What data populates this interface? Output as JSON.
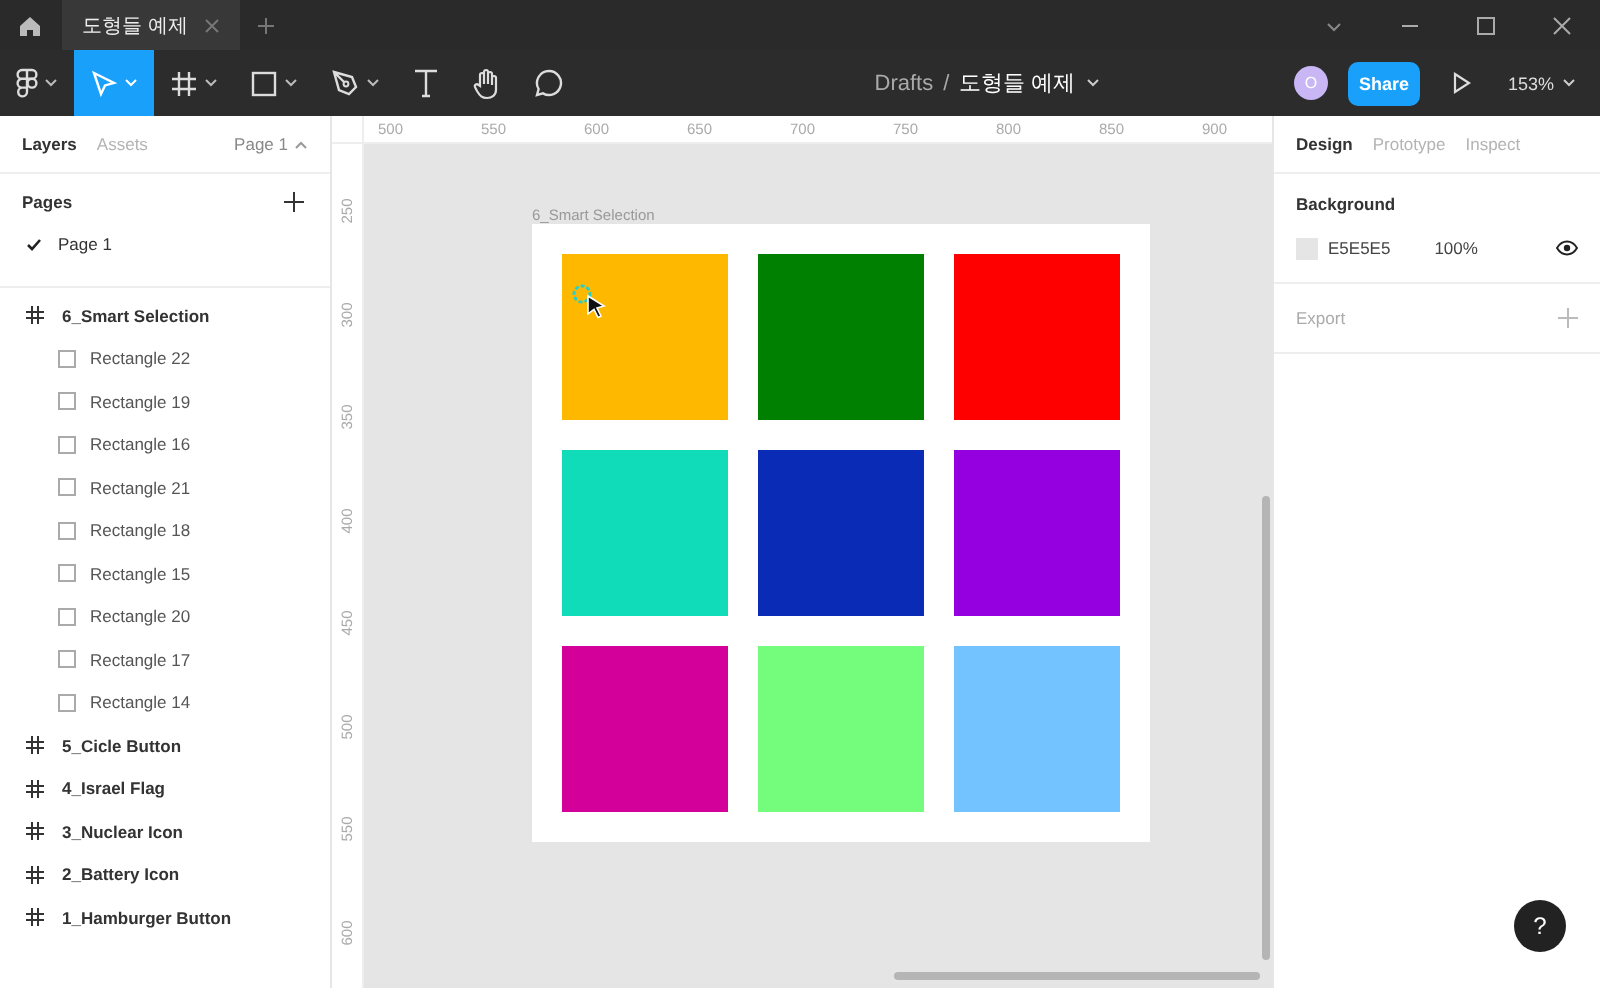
{
  "window": {
    "tab": {
      "title": "도형들 예제",
      "selected": true
    }
  },
  "toolbar": {
    "tools": [
      {
        "kind": "move",
        "selected": true
      },
      {
        "kind": "frame",
        "selected": false
      },
      {
        "kind": "rectangle",
        "selected": false
      },
      {
        "kind": "pen",
        "selected": false
      },
      {
        "kind": "text",
        "selected": false
      },
      {
        "kind": "hand",
        "selected": false
      },
      {
        "kind": "comment",
        "selected": false
      }
    ],
    "breadcrumb": {
      "folder": "Drafts",
      "separator": "/",
      "file": "도형들 예제"
    },
    "avatar": "O",
    "share": "Share",
    "zoom": "153%"
  },
  "left_panel": {
    "tabs": [
      {
        "label": "Layers",
        "selected": true
      },
      {
        "label": "Assets",
        "selected": false
      }
    ],
    "page_menu": "Page 1",
    "pages_heading": "Pages",
    "pages": [
      {
        "name": "Page 1",
        "selected": true
      }
    ],
    "layers": [
      {
        "name": "6_Smart Selection",
        "kind": "frame",
        "children": [
          {
            "name": "Rectangle 22",
            "kind": "rectangle"
          },
          {
            "name": "Rectangle 19",
            "kind": "rectangle"
          },
          {
            "name": "Rectangle 16",
            "kind": "rectangle"
          },
          {
            "name": "Rectangle 21",
            "kind": "rectangle"
          },
          {
            "name": "Rectangle 18",
            "kind": "rectangle"
          },
          {
            "name": "Rectangle 15",
            "kind": "rectangle"
          },
          {
            "name": "Rectangle 20",
            "kind": "rectangle"
          },
          {
            "name": "Rectangle 17",
            "kind": "rectangle"
          },
          {
            "name": "Rectangle 14",
            "kind": "rectangle"
          }
        ]
      },
      {
        "name": "5_Cicle Button",
        "kind": "frame"
      },
      {
        "name": "4_Israel Flag",
        "kind": "frame"
      },
      {
        "name": "3_Nuclear Icon",
        "kind": "frame"
      },
      {
        "name": "2_Battery Icon",
        "kind": "frame"
      },
      {
        "name": "1_Hamburger Button",
        "kind": "frame"
      }
    ]
  },
  "rulers": {
    "horizontal": [
      "500",
      "550",
      "600",
      "650",
      "700",
      "750",
      "800",
      "850",
      "900"
    ],
    "vertical": [
      "250",
      "300",
      "350",
      "400",
      "450",
      "500",
      "550",
      "600"
    ]
  },
  "canvas": {
    "frame_label": "6_Smart Selection",
    "rectangles": [
      {
        "color": "#ffb800"
      },
      {
        "color": "#008000"
      },
      {
        "color": "#ff0000"
      },
      {
        "color": "#10dcb9"
      },
      {
        "color": "#0a2bb5"
      },
      {
        "color": "#9500e0"
      },
      {
        "color": "#d3009a"
      },
      {
        "color": "#74fc7c"
      },
      {
        "color": "#72c3ff"
      }
    ]
  },
  "right_panel": {
    "tabs": [
      {
        "label": "Design",
        "selected": true
      },
      {
        "label": "Prototype",
        "selected": false
      },
      {
        "label": "Inspect",
        "selected": false
      }
    ],
    "background": {
      "heading": "Background",
      "hex": "E5E5E5",
      "opacity": "100%"
    },
    "export": "Export"
  },
  "help": "?"
}
